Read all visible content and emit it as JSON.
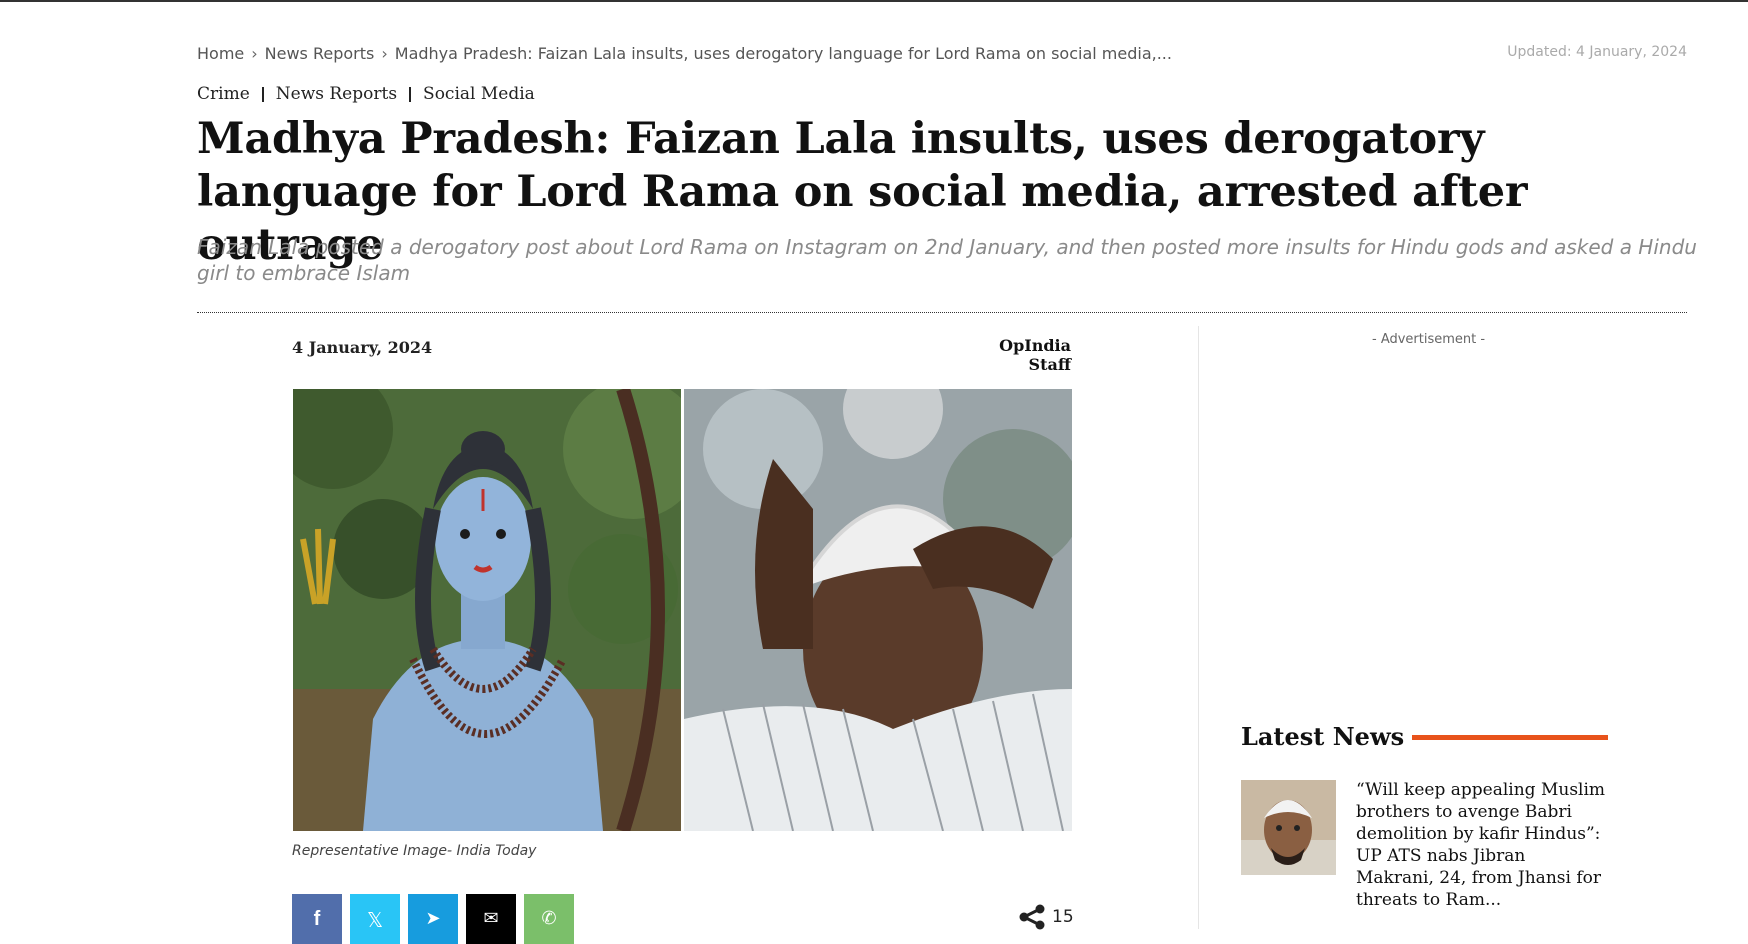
{
  "breadcrumb": {
    "items": [
      "Home",
      "News Reports",
      "Madhya Pradesh: Faizan Lala insults, uses derogatory language for Lord Rama on social media,..."
    ],
    "separator": "›"
  },
  "updated": "Updated: 4 January, 2024",
  "categories": [
    "Crime",
    "News Reports",
    "Social Media"
  ],
  "article": {
    "title": "Madhya Pradesh: Faizan Lala insults, uses derogatory language for Lord Rama on social media, arrested after outrage",
    "subtitle": "Faizan Lala posted a derogatory post about Lord Rama on Instagram on 2nd January, and then posted more insults for Hindu gods and asked a Hindu girl to embrace Islam",
    "date": "4 January, 2024",
    "author": "OpIndia Staff",
    "image_caption": "Representative Image- India Today"
  },
  "share": {
    "buttons": [
      {
        "name": "facebook",
        "icon": "facebook-icon",
        "color": "#516eab",
        "glyph": "f"
      },
      {
        "name": "twitter",
        "icon": "x-icon",
        "color": "#29c5f6",
        "glyph": "𝕏"
      },
      {
        "name": "telegram",
        "icon": "telegram-icon",
        "color": "#179cde",
        "glyph": "➤"
      },
      {
        "name": "email",
        "icon": "email-icon",
        "color": "#000000",
        "glyph": "✉"
      },
      {
        "name": "whatsapp",
        "icon": "whatsapp-icon",
        "color": "#7bbf6a",
        "glyph": "✆"
      }
    ],
    "count": "15"
  },
  "sidebar": {
    "ad_label": "- Advertisement -",
    "latest_title": "Latest News",
    "accent_color": "#e8531b",
    "latest": [
      {
        "title": "“Will keep appealing Muslim brothers to avenge Babri demolition by kafir Hindus”: UP ATS nabs Jibran Makrani, 24, from Jhansi for threats to Ram..."
      }
    ]
  }
}
